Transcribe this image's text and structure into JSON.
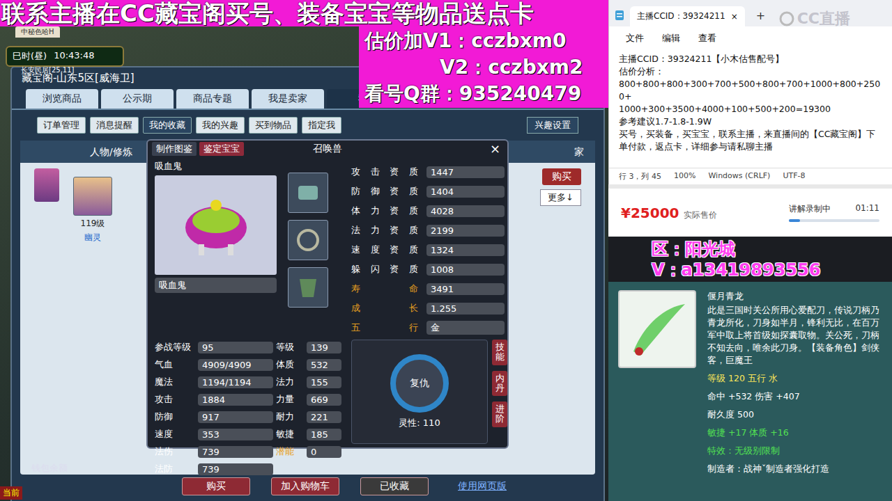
{
  "banner": "联系主播在CC藏宝阁买号、装备宝宝等物品送点卡",
  "overlay_lines": [
    "估价加V1：cczbxm0",
    "V2：cczbxm2",
    "看号Q群：935240479"
  ],
  "game": {
    "hud_tab": "中秘色哈H",
    "hud_period": "巳时(昼)",
    "hud_time": "10:43:48",
    "hud_location": "长安民居[25,11]",
    "window_title": "藏宝阁-山东5区[威海卫]",
    "tabs": [
      {
        "label": "浏览商品",
        "selected": false
      },
      {
        "label": "公示期",
        "selected": false
      },
      {
        "label": "商品专题",
        "selected": false
      },
      {
        "label": "我是卖家",
        "selected": false
      },
      {
        "label": "我",
        "selected": true
      }
    ],
    "subtabs": [
      {
        "label": "订单管理",
        "selected": false
      },
      {
        "label": "消息提醒",
        "selected": false
      },
      {
        "label": "我的收藏",
        "selected": true
      },
      {
        "label": "我的兴趣",
        "selected": false
      },
      {
        "label": "买到物品",
        "selected": false
      },
      {
        "label": "指定我",
        "selected": false
      }
    ],
    "interest_button": "兴趣设置",
    "list_headers": [
      "人物/修炼",
      "家"
    ],
    "buy_button": "购买",
    "more_button": "更多↓",
    "character": {
      "level": "119级",
      "school": "幽灵"
    },
    "wallet": "钱包余额",
    "chat_label": "当前",
    "footer_buttons": [
      {
        "label": "购买",
        "kind": "primary"
      },
      {
        "label": "加入购物车",
        "kind": "primary"
      },
      {
        "label": "已收藏",
        "kind": "muted"
      },
      {
        "label": "使用网页版",
        "kind": "link"
      }
    ]
  },
  "pet": {
    "tabs": [
      {
        "label": "制作图鉴",
        "selected": false
      },
      {
        "label": "鉴定宝宝",
        "selected": true
      }
    ],
    "title": "召唤兽",
    "close": "×",
    "name": "吸血鬼",
    "name_field": "吸血鬼",
    "attributes": [
      {
        "label": "攻击资质",
        "value": "1447",
        "highlight": false
      },
      {
        "label": "防御资质",
        "value": "1404",
        "highlight": false
      },
      {
        "label": "体力资质",
        "value": "4028",
        "highlight": false
      },
      {
        "label": "法力资质",
        "value": "2199",
        "highlight": false
      },
      {
        "label": "速度资质",
        "value": "1324",
        "highlight": false
      },
      {
        "label": "躲闪资质",
        "value": "1008",
        "highlight": false
      },
      {
        "label": "寿命",
        "value": "3491",
        "highlight": true
      },
      {
        "label": "成长",
        "value": "1.255",
        "highlight": true
      },
      {
        "label": "五行",
        "value": "金",
        "highlight": true
      }
    ],
    "stats": [
      [
        {
          "label": "参战等级",
          "value": "95",
          "highlight": false
        },
        {
          "label": "等级",
          "value": "139",
          "highlight": false
        }
      ],
      [
        {
          "label": "气血",
          "value": "4909/4909",
          "highlight": false
        },
        {
          "label": "体质",
          "value": "532",
          "highlight": false
        }
      ],
      [
        {
          "label": "魔法",
          "value": "1194/1194",
          "highlight": false
        },
        {
          "label": "法力",
          "value": "155",
          "highlight": false
        }
      ],
      [
        {
          "label": "攻击",
          "value": "1884",
          "highlight": false
        },
        {
          "label": "力量",
          "value": "669",
          "highlight": false
        }
      ],
      [
        {
          "label": "防御",
          "value": "917",
          "highlight": false
        },
        {
          "label": "耐力",
          "value": "221",
          "highlight": false
        }
      ],
      [
        {
          "label": "速度",
          "value": "353",
          "highlight": false
        },
        {
          "label": "敏捷",
          "value": "185",
          "highlight": false
        }
      ],
      [
        {
          "label": "法伤",
          "value": "739",
          "highlight": false
        },
        {
          "label": "潜能",
          "value": "0",
          "highlight": true
        }
      ],
      [
        {
          "label": "法防",
          "value": "739",
          "highlight": false
        }
      ]
    ],
    "skill": "复仇",
    "spirit": "灵性: 110",
    "side_buttons": [
      "技能",
      "内丹",
      "进阶"
    ]
  },
  "notepad": {
    "tab_title": "主播CCID：39324211",
    "close": "×",
    "add": "+",
    "watermark": "CC直播",
    "menu": [
      "文件",
      "编辑",
      "查看"
    ],
    "lines": [
      "主播CCID：39324211【小木估售配号】",
      "估价分析：",
      "800+800+800+300+700+500+800+700+1000+800+2500+",
      "1000+300+3500+4000+100+500+200=19300",
      "参考建议1.7-1.8-1.9W",
      "买号，买装备，买宝宝，联系主播，来直播间的【CC藏宝阁】下单付款，返点卡，详细参与请私聊主播"
    ],
    "status": [
      "行 3，列 45",
      "100%",
      "Windows (CRLF)",
      "UTF-8"
    ]
  },
  "price": {
    "amount": "¥25000",
    "label": "实际售价",
    "recording": "讲解录制中",
    "time": "01:11",
    "level": 0.12
  },
  "promo_lines": [
    "区：阳光城",
    "V：a13419893556"
  ],
  "item": {
    "name": "偃月青龙",
    "description": "此是三国时关公所用心爱配刀，传说刀柄乃青龙所化，刀身如半月，锋利无比，在百万军中取上将首级如探囊取物。关公死，刀柄不知去向，唯余此刀身。",
    "roles": "【装备角色】剑侠客，巨魔王",
    "lines": [
      {
        "text": "等级 120 五行 水",
        "kind": "level"
      },
      {
        "text": "命中 +532 伤害 +407",
        "kind": "base"
      },
      {
        "text": "耐久度 500",
        "kind": "base"
      },
      {
        "text": "敏捷 +17 体质 +16",
        "kind": "bonus"
      },
      {
        "text": "特效：无级别限制",
        "kind": "bonus"
      },
      {
        "text": "制造者：战神ˇ制造者强化打造",
        "kind": "base"
      }
    ]
  }
}
